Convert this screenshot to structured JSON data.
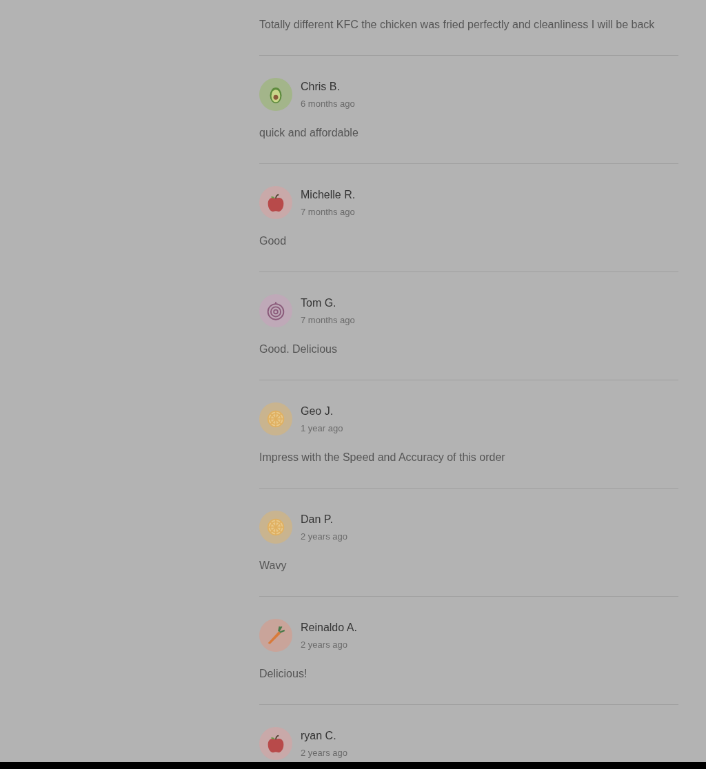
{
  "reviews": [
    {
      "comment": "Totally different KFC the chicken was fried perfectly and cleanliness I will be back"
    },
    {
      "name": "Chris B.",
      "date": "6 months ago",
      "avatar": {
        "kind": "avocado"
      },
      "comment": "quick and affordable"
    },
    {
      "name": "Michelle R.",
      "date": "7 months ago",
      "avatar": {
        "kind": "apple"
      },
      "comment": "Good"
    },
    {
      "name": "Tom G.",
      "date": "7 months ago",
      "avatar": {
        "kind": "onion"
      },
      "comment": "Good. Delicious"
    },
    {
      "name": "Geo J.",
      "date": "1 year ago",
      "avatar": {
        "kind": "lemon"
      },
      "comment": "Impress with the Speed and Accuracy of this order"
    },
    {
      "name": "Dan P.",
      "date": "2 years ago",
      "avatar": {
        "kind": "lemon"
      },
      "comment": "Wavy"
    },
    {
      "name": "Reinaldo A.",
      "date": "2 years ago",
      "avatar": {
        "kind": "carrot"
      },
      "comment": "Delicious!"
    },
    {
      "name": "ryan C.",
      "date": "2 years ago",
      "avatar": {
        "kind": "apple"
      }
    }
  ]
}
